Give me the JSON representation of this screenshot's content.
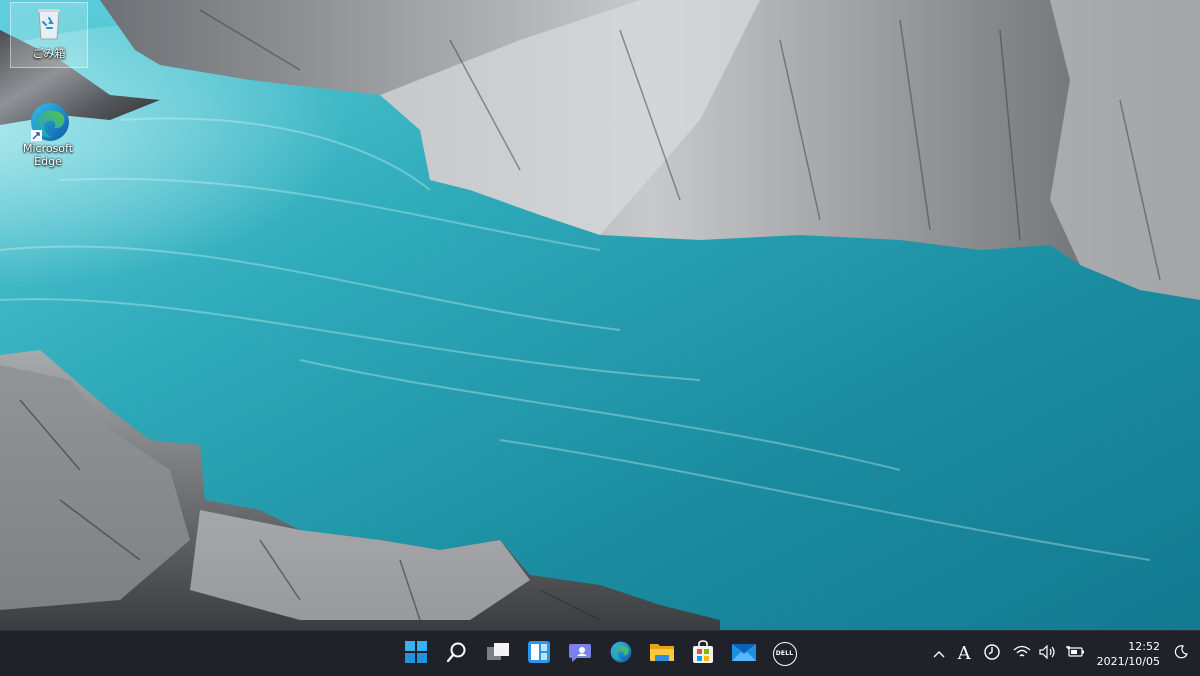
{
  "desktop": {
    "icons": [
      {
        "label": "ごみ箱",
        "icon": "recycle-bin-icon",
        "selected": true
      },
      {
        "label": "Microsoft Edge",
        "icon": "edge-icon",
        "shortcut": true
      }
    ]
  },
  "taskbar": {
    "pinned": [
      {
        "name": "start",
        "icon": "windows-start-icon"
      },
      {
        "name": "search",
        "icon": "search-icon"
      },
      {
        "name": "task-view",
        "icon": "task-view-icon"
      },
      {
        "name": "widgets",
        "icon": "widgets-icon"
      },
      {
        "name": "chat",
        "icon": "teams-chat-icon"
      },
      {
        "name": "edge",
        "icon": "edge-icon"
      },
      {
        "name": "file-explorer",
        "icon": "folder-icon"
      },
      {
        "name": "store",
        "icon": "store-icon"
      },
      {
        "name": "mail",
        "icon": "mail-icon"
      },
      {
        "name": "dell",
        "icon": "dell-icon",
        "label": "DELL"
      }
    ],
    "tray": {
      "ime_mode": "A",
      "time": "12:52",
      "date": "2021/10/05"
    }
  },
  "colors": {
    "taskbar_bg": "#1f2228",
    "water": "#1e8a9c",
    "accent_blue": "#0078d4"
  }
}
